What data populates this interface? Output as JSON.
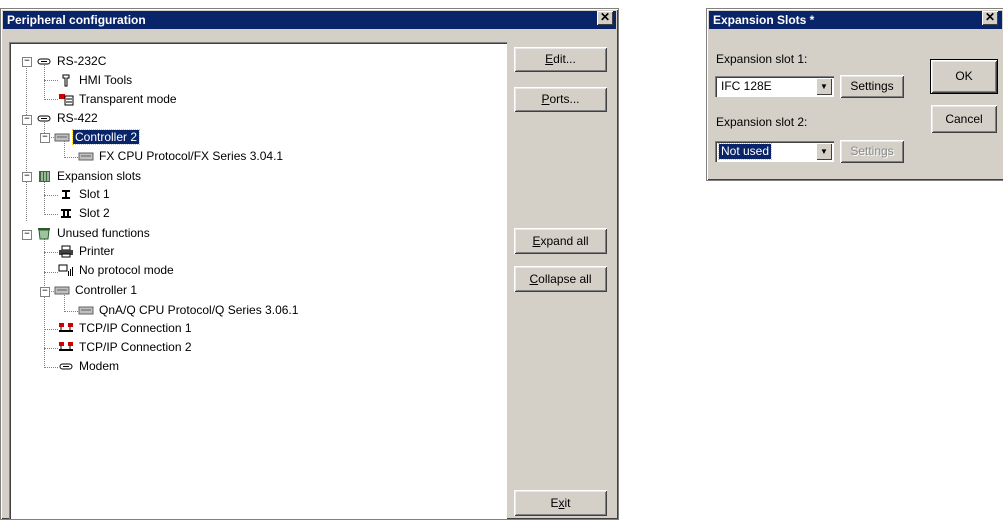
{
  "peripheral": {
    "title": "Peripheral configuration",
    "close": "✕",
    "buttons": {
      "edit": {
        "pre": "",
        "ul": "E",
        "post": "dit..."
      },
      "ports": {
        "pre": "",
        "ul": "P",
        "post": "orts..."
      },
      "expand_all": {
        "pre": "",
        "ul": "E",
        "post": "xpand all"
      },
      "collapse_all": {
        "pre": "",
        "ul": "C",
        "post": "ollapse all"
      },
      "exit": {
        "pre": "E",
        "ul": "x",
        "post": "it"
      }
    },
    "tree": [
      {
        "label": "RS-232C",
        "icon": "serial-port-icon"
      },
      {
        "label": "HMI Tools",
        "icon": "tool-icon"
      },
      {
        "label": "Transparent mode",
        "icon": "transparent-mode-icon"
      },
      {
        "label": "RS-422",
        "icon": "serial-port-icon"
      },
      {
        "label": "Controller 2",
        "icon": "controller-icon",
        "selected": true
      },
      {
        "label": "FX CPU Protocol/FX Series 3.04.1",
        "icon": "controller-icon"
      },
      {
        "label": "Expansion slots",
        "icon": "expansion-slots-icon"
      },
      {
        "label": "Slot 1",
        "icon": "slot-1-icon"
      },
      {
        "label": "Slot 2",
        "icon": "slot-2-icon"
      },
      {
        "label": "Unused functions",
        "icon": "recycle-bin-icon"
      },
      {
        "label": "Printer",
        "icon": "printer-icon"
      },
      {
        "label": "No protocol mode",
        "icon": "no-protocol-icon"
      },
      {
        "label": "Controller 1",
        "icon": "controller-icon"
      },
      {
        "label": "QnA/Q CPU Protocol/Q Series 3.06.1",
        "icon": "controller-icon"
      },
      {
        "label": "TCP/IP Connection 1",
        "icon": "network-icon"
      },
      {
        "label": "TCP/IP Connection 2",
        "icon": "network-icon"
      },
      {
        "label": "Modem",
        "icon": "modem-icon"
      }
    ]
  },
  "expansion": {
    "title": "Expansion Slots *",
    "close": "✕",
    "slot1_label": "Expansion slot 1:",
    "slot1_value": "IFC 128E",
    "slot2_label": "Expansion slot 2:",
    "slot2_value": "Not used",
    "settings": "Settings",
    "ok": "OK",
    "cancel": "Cancel"
  },
  "colors": {
    "titlebar": "#0a246a",
    "face": "#d4d0c8",
    "selection": "#0a246a"
  }
}
